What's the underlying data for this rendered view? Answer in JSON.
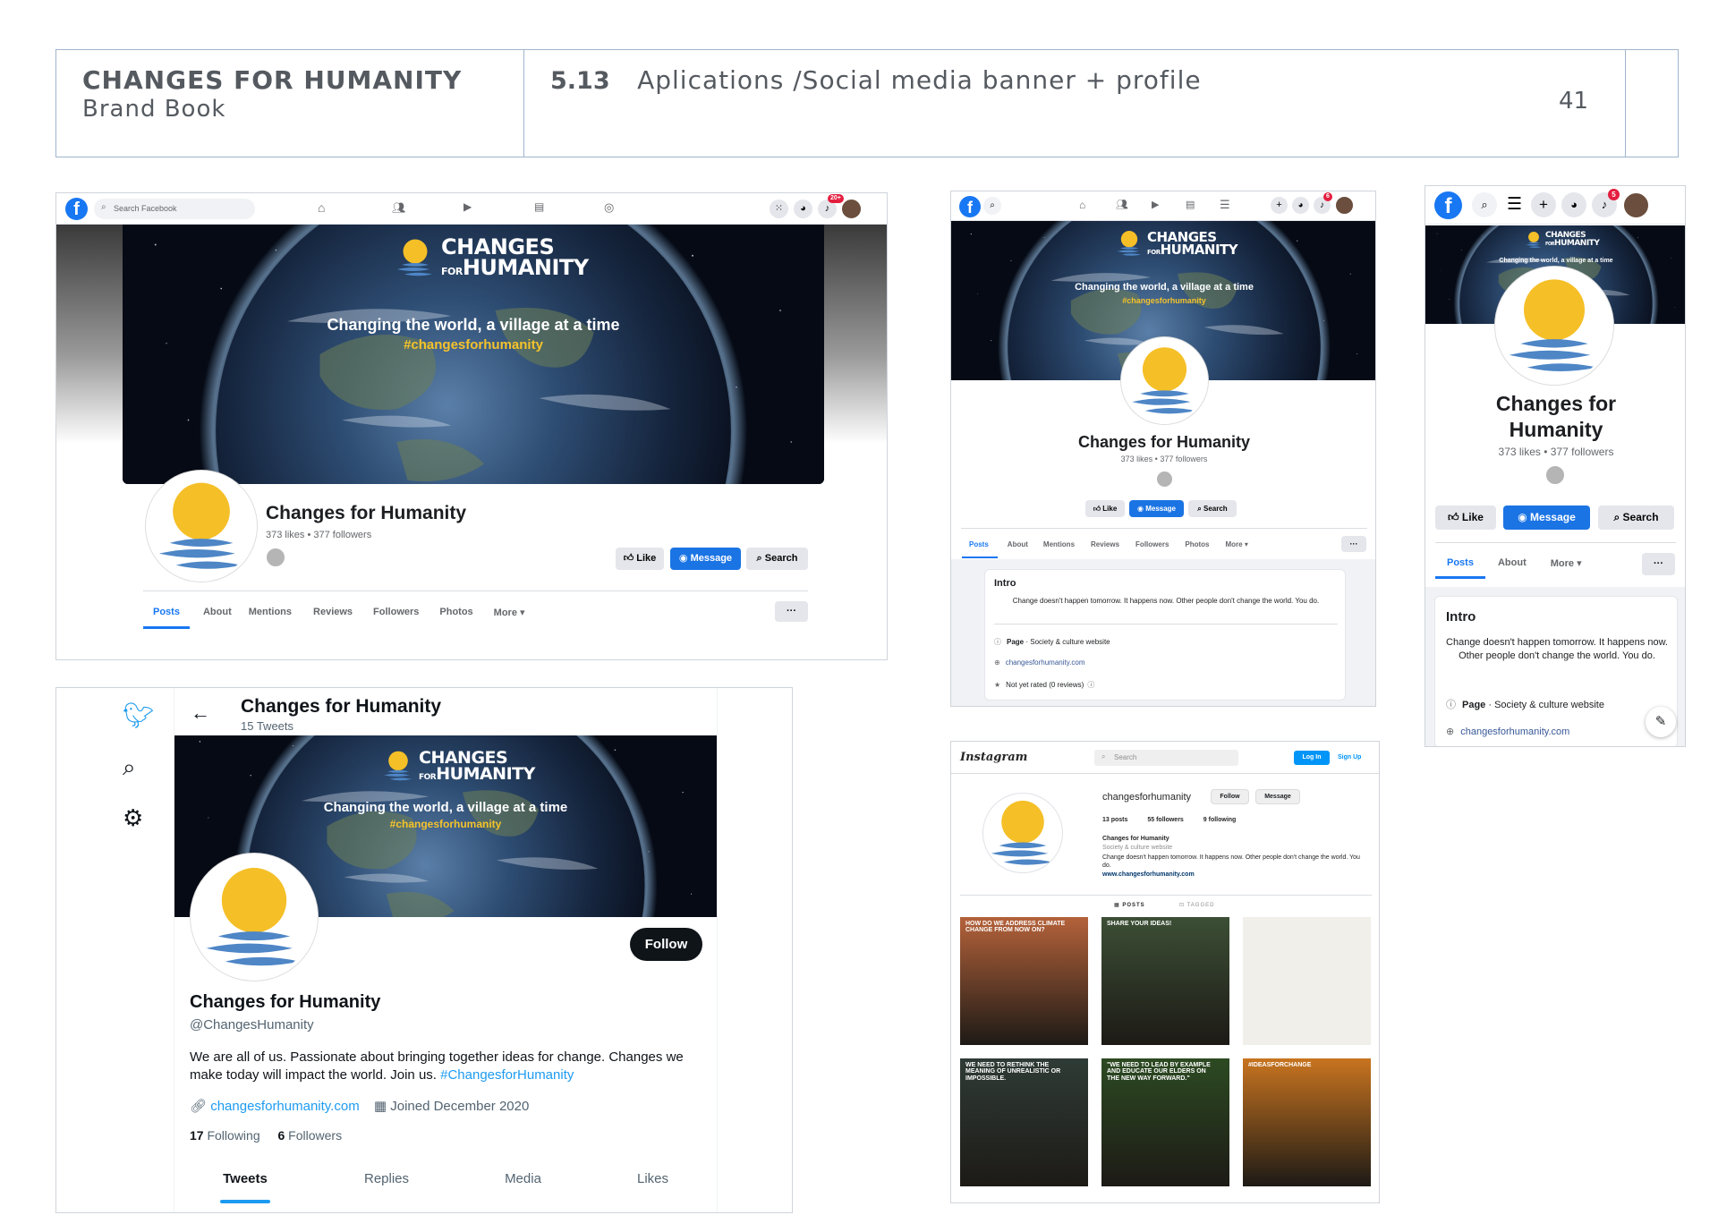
{
  "header": {
    "brand": "CHANGES FOR HUMANITY",
    "brand_sub": "Brand Book",
    "section_num": "5.13",
    "section_title": "Aplications /Social media banner + profile",
    "page": "41"
  },
  "cover": {
    "logo_top": "CHANGES",
    "logo_for": "FOR",
    "logo_bottom": "HUMANITY",
    "slogan": "Changing the world, a village at a time",
    "hashtag": "#changesforhumanity"
  },
  "facebook_desktop": {
    "search_placeholder": "Search Facebook",
    "notif_badge": "20+",
    "page_name": "Changes for Humanity",
    "stats": "373 likes • 377 followers",
    "like": "Like",
    "message": "Message",
    "search": "Search",
    "tabs": [
      "Posts",
      "About",
      "Mentions",
      "Reviews",
      "Followers",
      "Photos",
      "More ▾"
    ],
    "more_dots": "···"
  },
  "facebook_tablet": {
    "notif_badge": "6",
    "page_name": "Changes for Humanity",
    "stats": "373 likes • 377 followers",
    "like": "Like",
    "message": "Message",
    "search": "Search",
    "tabs": [
      "Posts",
      "About",
      "Mentions",
      "Reviews",
      "Followers",
      "Photos",
      "More ▾"
    ],
    "more_dots": "···",
    "intro_title": "Intro",
    "intro_text": "Change doesn't happen tomorrow. It happens now. Other people don't change the world. You do.",
    "page_label": "Page",
    "category": " · Society & culture website",
    "website": "changesforhumanity.com",
    "rating": "Not yet rated (0 reviews)"
  },
  "facebook_mobile": {
    "notif_badge": "5",
    "page_name_1": "Changes for",
    "page_name_2": "Humanity",
    "stats": "373 likes • 377 followers",
    "like": "Like",
    "message": "Message",
    "search": "Search",
    "tabs": [
      "Posts",
      "About",
      "More ▾"
    ],
    "more_dots": "···",
    "intro_title": "Intro",
    "intro_text": "Change doesn't happen tomorrow. It happens now. Other people don't change the world. You do.",
    "page_label": "Page",
    "category": " · Society & culture website",
    "website": "changesforhumanity.com"
  },
  "twitter": {
    "name": "Changes for Humanity",
    "tweet_count": "15 Tweets",
    "follow": "Follow",
    "handle": "@ChangesHumanity",
    "bio": "We are all of us. Passionate about bringing together ideas for change. Changes we make today will impact the world. Join us. ",
    "bio_tag": "#ChangesforHumanity",
    "website": "changesforhumanity.com",
    "joined": "Joined December 2020",
    "following_count": "17",
    "following_label": " Following",
    "followers_count": "6",
    "followers_label": " Followers",
    "tabs": [
      "Tweets",
      "Replies",
      "Media",
      "Likes"
    ]
  },
  "instagram": {
    "logo": "Instagram",
    "search_placeholder": "Search",
    "login": "Log In",
    "signup": "Sign Up",
    "username": "changesforhumanity",
    "follow": "Follow",
    "message": "Message",
    "posts": "13 posts",
    "followers": "55 followers",
    "following": "9 following",
    "name": "Changes for Humanity",
    "category": "Society & culture website",
    "bio": "Change doesn't happen tomorrow. It happens now. Other people don't change the world. You do.",
    "url": "www.changesforhumanity.com",
    "tab_posts": "▦ POSTS",
    "tab_tagged": "⊡ TAGGED",
    "tiles": [
      {
        "caption": "HOW DO WE ADDRESS CLIMATE CHANGE FROM NOW ON?",
        "bg": "#b4623a"
      },
      {
        "caption": "SHARE YOUR IDEAS!",
        "bg": "#3c4f35"
      },
      {
        "caption": "",
        "bg": "#f1efe9"
      },
      {
        "caption": "WE NEED TO RETHINK THE MEANING OF UNREALISTIC OR IMPOSSIBLE.",
        "bg": "#2f3b36"
      },
      {
        "caption": "\"WE NEED TO LEAD BY EXAMPLE AND EDUCATE OUR ELDERS ON THE NEW WAY FORWARD.\"",
        "bg": "#2c4a22"
      },
      {
        "caption": "#IDEASFORCHANGE",
        "bg": "#c8741f"
      }
    ]
  },
  "colors": {
    "fb_blue": "#1877f2",
    "tw_blue": "#1d9bf0",
    "sun_yellow": "#f5bf27",
    "wave_blue": "#4e86c6",
    "hashtag_yellow": "#f5c32b"
  }
}
